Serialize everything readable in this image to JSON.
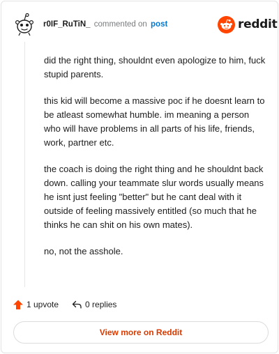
{
  "header": {
    "username": "r0IF_RuTiN_",
    "commented_text": "commented on",
    "post_link": "post"
  },
  "brand": {
    "logo_text": "reddit",
    "accent_color": "#ff4500"
  },
  "comment": {
    "paragraphs": [
      "did the right thing, shouldnt even apologize to him, fuck stupid parents.",
      "this kid will become a massive poc if he doesnt learn to be atleast somewhat humble. im meaning a person who will have problems in all parts of his life, friends, work, partner etc.",
      "the coach is doing the right thing and he shouldnt back down. calling your teammate slur words usually means he isnt just feeling \"better\" but he cant deal with it outside of feeling massively entitled (so much that he thinks he can shit on his own mates).",
      "no, not the asshole."
    ]
  },
  "actions": {
    "upvote_label": "1 upvote",
    "upvote_icon": "upvote-arrow-icon",
    "replies_label": "0 replies",
    "replies_icon": "reply-arrow-icon"
  },
  "footer": {
    "view_more_label": "View more on Reddit"
  }
}
